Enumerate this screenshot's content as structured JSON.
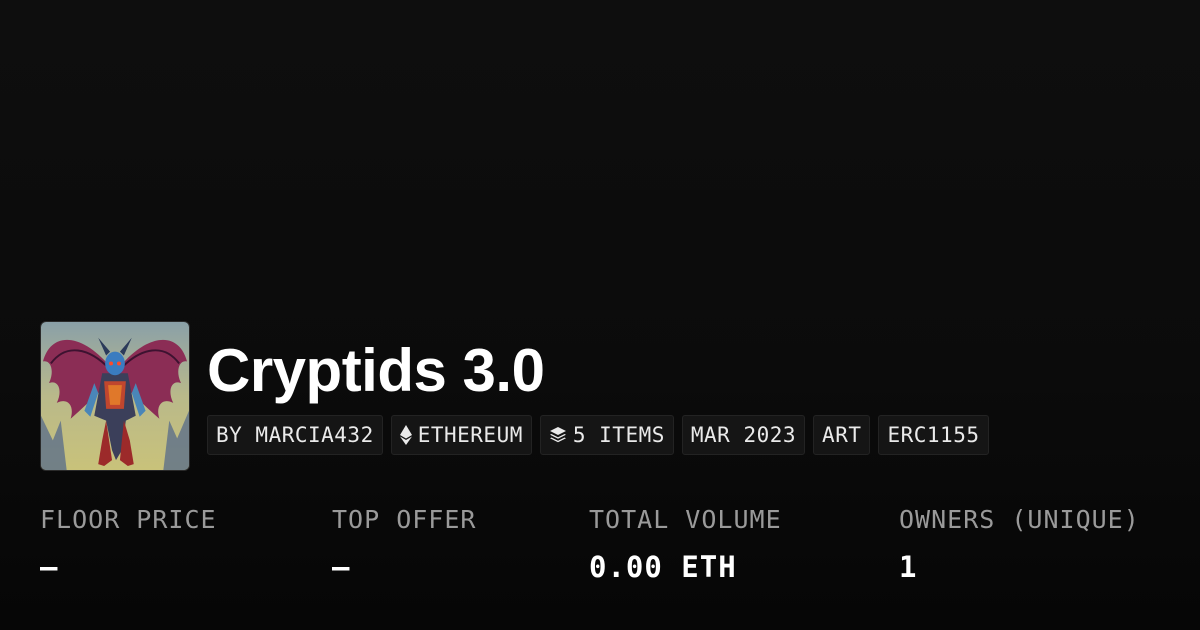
{
  "collection": {
    "title": "Cryptids 3.0",
    "image_alt": "winged demon creature artwork"
  },
  "tags": [
    {
      "label": "BY MARCIA432",
      "icon": ""
    },
    {
      "label": "ETHEREUM",
      "icon": "ethereum-icon"
    },
    {
      "label": "5 ITEMS",
      "icon": "layers-icon"
    },
    {
      "label": "MAR 2023",
      "icon": ""
    },
    {
      "label": "ART",
      "icon": ""
    },
    {
      "label": "ERC1155",
      "icon": ""
    }
  ],
  "stats": [
    {
      "label": "FLOOR PRICE",
      "value": "—"
    },
    {
      "label": "TOP OFFER",
      "value": "—"
    },
    {
      "label": "TOTAL VOLUME",
      "value": "0.00 ETH"
    },
    {
      "label": "OWNERS (UNIQUE)",
      "value": "1"
    }
  ],
  "colors": {
    "background": "#0b0b0b",
    "tag_background": "#151515",
    "label_gray": "#9a9a9a",
    "text": "#ffffff"
  }
}
